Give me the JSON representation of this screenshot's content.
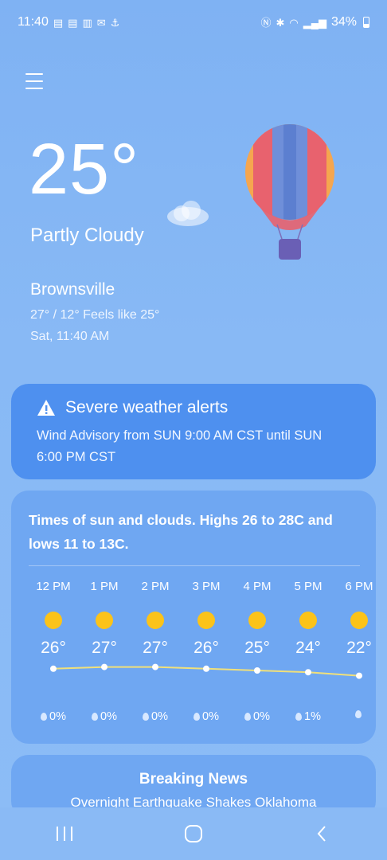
{
  "status_bar": {
    "time": "11:40",
    "battery": "34%"
  },
  "weather": {
    "temperature": "25°",
    "condition": "Partly Cloudy",
    "location": "Brownsville",
    "high_low_feels": "27° / 12° Feels like 25°",
    "datetime": "Sat, 11:40 AM"
  },
  "alert": {
    "title": "Severe weather alerts",
    "text": "Wind Advisory from SUN 9:00 AM CST until SUN 6:00 PM CST"
  },
  "forecast": {
    "summary": "Times of sun and clouds. Highs 26 to 28C and lows 11 to 13C.",
    "hours": [
      {
        "time": "12 PM",
        "temp": "26°",
        "precip": "0%",
        "value": 26
      },
      {
        "time": "1 PM",
        "temp": "27°",
        "precip": "0%",
        "value": 27
      },
      {
        "time": "2 PM",
        "temp": "27°",
        "precip": "0%",
        "value": 27
      },
      {
        "time": "3 PM",
        "temp": "26°",
        "precip": "0%",
        "value": 26
      },
      {
        "time": "4 PM",
        "temp": "25°",
        "precip": "0%",
        "value": 25
      },
      {
        "time": "5 PM",
        "temp": "24°",
        "precip": "1%",
        "value": 24
      },
      {
        "time": "6 PM",
        "temp": "22°",
        "precip": "",
        "value": 22
      }
    ]
  },
  "news": {
    "title": "Breaking News",
    "headline": "Overnight Earthquake Shakes Oklahoma"
  },
  "colors": {
    "sun": "#fbc31a",
    "alert_bg": "#4e90ef",
    "card_bg": "#6fa7f2",
    "temp_line": "#f0e07a"
  }
}
